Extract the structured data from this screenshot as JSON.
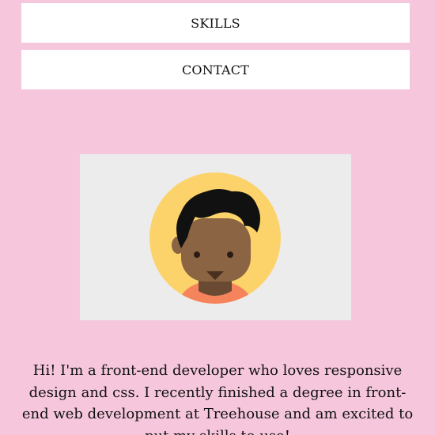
{
  "nav": {
    "items": [
      {
        "label": "SKILLS"
      },
      {
        "label": "CONTACT"
      }
    ]
  },
  "profile": {
    "avatar_icon": "person-avatar-icon",
    "colors": {
      "background": "#f6c7dc",
      "card": "#ececec",
      "avatar_circle": "#fcd36a",
      "skin": "#8b6443",
      "hair": "#111111",
      "shirt": "#f5835c"
    }
  },
  "bio": {
    "text": "Hi! I'm a front-end developer who loves responsive design and css. I recently finished a degree in front-end web development at Treehouse and am excited to put my skills to use!"
  }
}
